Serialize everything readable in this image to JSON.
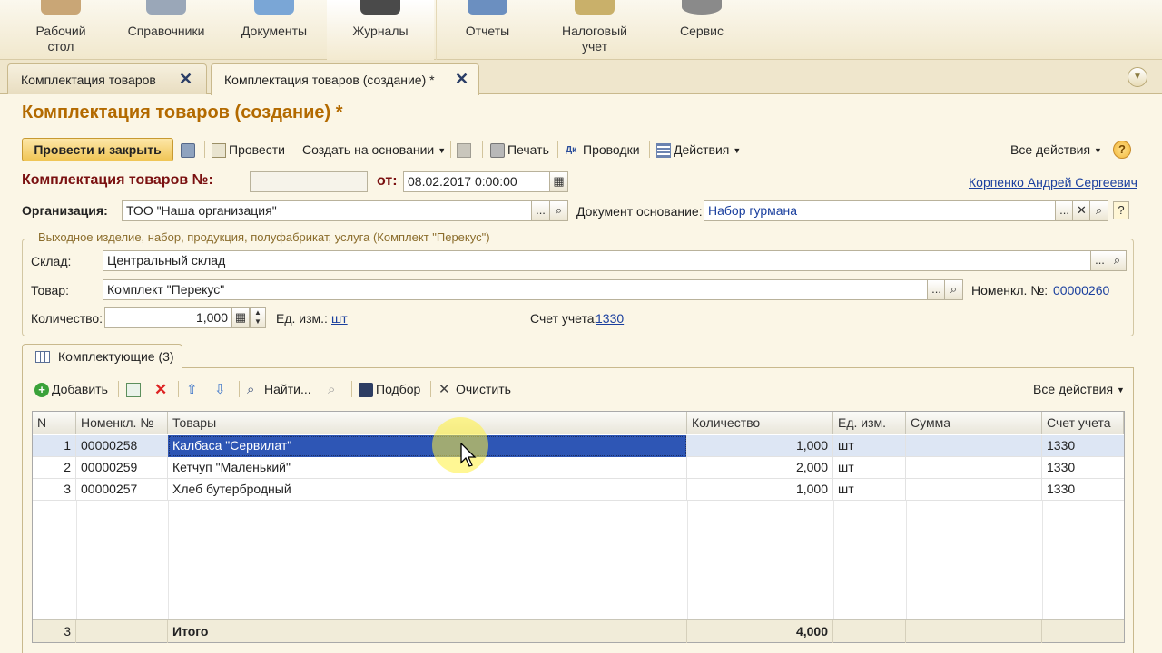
{
  "nav": {
    "items": [
      {
        "label": "Рабочий\nстол",
        "icon": "desktop-icon",
        "color": "#c9a676"
      },
      {
        "label": "Справочники",
        "icon": "directory-icon",
        "color": "#9aa7b8"
      },
      {
        "label": "Документы",
        "icon": "documents-icon",
        "color": "#7aa6d6"
      },
      {
        "label": "Журналы",
        "icon": "journals-icon",
        "color": "#4a4a4a"
      },
      {
        "label": "Отчеты",
        "icon": "reports-icon",
        "color": "#6b8fc0"
      },
      {
        "label": "Налоговый\nучет",
        "icon": "tax-icon",
        "color": "#c9b06a"
      },
      {
        "label": "Сервис",
        "icon": "service-icon",
        "color": "#8a8a8a"
      }
    ]
  },
  "tabs": [
    {
      "label": "Комплектация товаров",
      "close": "✕"
    },
    {
      "label": "Комплектация товаров (создание) *",
      "close": "✕"
    }
  ],
  "header": {
    "title": "Комплектация товаров (создание) *"
  },
  "toolbar": {
    "post_close": "Провести и закрыть",
    "post": "Провести",
    "create_based": "Создать на основании",
    "print": "Печать",
    "entries": "Проводки",
    "actions": "Действия",
    "all_actions": "Все действия",
    "help": "?"
  },
  "form": {
    "number_label": "Комплектация товаров №:",
    "number_value": "",
    "date_label": "от:",
    "date_value": "08.02.2017  0:00:00",
    "responsible": "Корпенко Андрей Сергеевич",
    "org_label": "Организация:",
    "org_value": "ТОО \"Наша организация\"",
    "basis_label": "Документ основание:",
    "basis_value": "Набор гурмана",
    "group_title": "Выходное изделие, набор, продукция, полуфабрикат, услуга (Комплект \"Перекус\")",
    "warehouse_label": "Склад:",
    "warehouse_value": "Центральный склад",
    "goods_label": "Товар:",
    "goods_value": "Комплект \"Перекус\"",
    "nomen_label": "Номенкл. №:",
    "nomen_value": "00000260",
    "qty_label": "Количество:",
    "qty_value": "1,000",
    "unit_label": "Ед. изм.:",
    "unit_value": "шт",
    "account_label": "Счет учета:",
    "account_value": "1330",
    "ellipsis": "...",
    "clear": "✕",
    "search": "🔍"
  },
  "panel": {
    "tab_label": "Комплектующие (3)",
    "add": "Добавить",
    "find": "Найти...",
    "pick": "Подбор",
    "clear": "Очистить",
    "all_actions": "Все действия"
  },
  "table": {
    "columns": [
      "N",
      "Номенкл. №",
      "Товары",
      "Количество",
      "Ед. изм.",
      "Сумма",
      "Счет учета"
    ],
    "rows": [
      {
        "n": "1",
        "code": "00000258",
        "name": "Калбаса \"Сервилат\"",
        "qty": "1,000",
        "unit": "шт",
        "sum": "",
        "account": "1330"
      },
      {
        "n": "2",
        "code": "00000259",
        "name": "Кетчуп \"Маленький\"",
        "qty": "2,000",
        "unit": "шт",
        "sum": "",
        "account": "1330"
      },
      {
        "n": "3",
        "code": "00000257",
        "name": "Хлеб бутербродный",
        "qty": "1,000",
        "unit": "шт",
        "sum": "",
        "account": "1330"
      }
    ],
    "footer": {
      "n": "3",
      "label": "Итого",
      "qty": "4,000"
    }
  }
}
